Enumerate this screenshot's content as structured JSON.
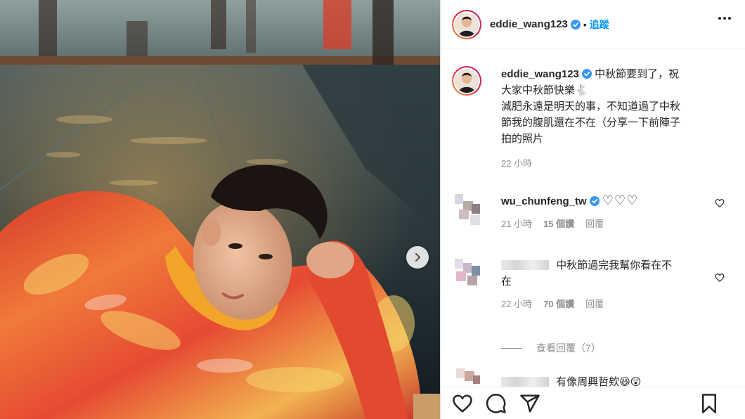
{
  "post": {
    "username": "eddie_wang123",
    "follow_label": "追蹤",
    "separator": "•"
  },
  "caption": {
    "username": "eddie_wang123",
    "text": "中秋節要到了，祝大家中秋節快樂🐇\n減肥永遠是明天的事，不知道過了中秋節我的腹肌還在不在（分享一下前陣子拍的照片",
    "line1": "中秋節要到了，祝",
    "line2": "大家中秋節快樂",
    "line3": "減肥永遠是明天的事，不知道過了中秋",
    "line4": "節我的腹肌還在不在（分享一下前陣子",
    "line5": "拍的照片",
    "time": "22 小時"
  },
  "comments": [
    {
      "username": "wu_chunfeng_tw",
      "text": "♡♡♡",
      "time": "21 小時",
      "likes": "15 個讚",
      "reply_label": "回覆"
    },
    {
      "username": "",
      "text_line1": "中秋節過完我幫你看在不",
      "text_line2": "在",
      "time": "22 小時",
      "likes": "70 個讚",
      "reply_label": "回覆",
      "view_replies": "查看回覆（7）"
    },
    {
      "username": "",
      "text": "有像周興哲欸😆😲"
    }
  ],
  "colors": {
    "link": "#0095f6",
    "text": "#262626",
    "muted": "#8e8e8e",
    "verified": "#3897f0"
  },
  "icons": [
    "verified-badge-icon",
    "more-options-icon",
    "next-arrow-icon",
    "heart-icon",
    "comment-icon",
    "share-icon",
    "bookmark-icon"
  ]
}
